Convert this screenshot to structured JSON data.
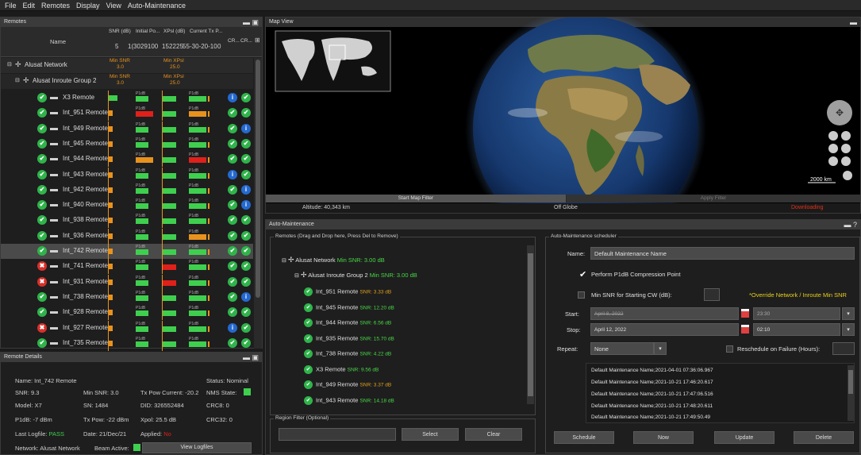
{
  "menu": [
    "File",
    "Edit",
    "Remotes",
    "Display",
    "View",
    "Auto-Maintenance"
  ],
  "remotes_panel": {
    "title": "Remotes",
    "col_name": "Name",
    "col_snr": "SNR (dB)",
    "col_initial": "Initial Po...",
    "col_xpsl": "XPsl (dB)",
    "col_tx": "Current Tx P...",
    "col_cr": "CR...",
    "col_cr2": "CR...",
    "scale_snr": "5",
    "scale_snr2": "1(",
    "scale_initial": "30",
    "scale_initial2": "29100",
    "scale_xpsl": "15",
    "scale_xpsl2": "22",
    "scale_xpsl3": "25",
    "scale_xpsl4": "55",
    "scale_tx": "-30-20-10",
    "scale_tx2": "0",
    "network": "Alusat Network",
    "network_min_snr": "Min SNR",
    "network_min_snr_val": "3.0",
    "network_min_xpsl": "Min XPsl",
    "network_min_xpsl_val": "25.0",
    "group": "Alusat Inroute Group 2",
    "group_min_snr": "Min SNR",
    "group_min_snr_val": "3.0",
    "group_min_xpsl": "Min XPsl",
    "group_min_xpsl_val": "25.0",
    "p1db": "P1dB",
    "rows": [
      {
        "name": "X3 Remote",
        "status": "ok",
        "i1": "info",
        "i2": "ok"
      },
      {
        "name": "Int_951 Remote",
        "status": "ok",
        "i1": "ok",
        "i2": "ok"
      },
      {
        "name": "Int_949 Remote",
        "status": "ok",
        "i1": "ok",
        "i2": "info"
      },
      {
        "name": "Int_945 Remote",
        "status": "ok",
        "i1": "ok",
        "i2": "ok"
      },
      {
        "name": "Int_944 Remote",
        "status": "ok",
        "i1": "ok",
        "i2": "ok"
      },
      {
        "name": "Int_943 Remote",
        "status": "ok",
        "i1": "info",
        "i2": "ok"
      },
      {
        "name": "Int_942 Remote",
        "status": "ok",
        "i1": "ok",
        "i2": "info"
      },
      {
        "name": "Int_940 Remote",
        "status": "ok",
        "i1": "ok",
        "i2": "info"
      },
      {
        "name": "Int_938 Remote",
        "status": "ok",
        "i1": "ok",
        "i2": "ok"
      },
      {
        "name": "Int_936 Remote",
        "status": "ok",
        "i1": "ok",
        "i2": "ok"
      },
      {
        "name": "Int_742 Remote",
        "status": "ok",
        "i1": "ok",
        "i2": "ok"
      },
      {
        "name": "Int_741 Remote",
        "status": "err",
        "i1": "ok",
        "i2": "ok"
      },
      {
        "name": "Int_931 Remote",
        "status": "err",
        "i1": "ok",
        "i2": "ok"
      },
      {
        "name": "Int_738 Remote",
        "status": "ok",
        "i1": "ok",
        "i2": "info"
      },
      {
        "name": "Int_928 Remote",
        "status": "ok",
        "i1": "ok",
        "i2": "ok"
      },
      {
        "name": "Int_927 Remote",
        "status": "err",
        "i1": "info",
        "i2": "ok"
      },
      {
        "name": "Int_735 Remote",
        "status": "ok",
        "i1": "ok",
        "i2": "ok"
      }
    ]
  },
  "details": {
    "title": "Remote Details",
    "name": "Name: Int_742 Remote",
    "status": "Status: Nominal",
    "snr": "SNR: 9.3",
    "min_snr": "Min SNR: 3.0",
    "tx_pow_current": "Tx Pow Current: -20.2",
    "nms_state": "NMS State:",
    "model": "Model: X7",
    "sn": "SN: 1484",
    "did": "DID: 326552484",
    "crc8": "CRC8: 0",
    "p1db": "P1dB: -7 dBm",
    "tx_pow": "Tx Pow: -22 dBm",
    "xpol": "Xpol: 25.5 dB",
    "crc32": "CRC32: 0",
    "last_logfile_label": "Last Logfile: ",
    "last_logfile_val": "PASS",
    "date": "Date: 21/Dec/21",
    "applied_label": "Applied: ",
    "applied_val": "No",
    "network": "Network: Alusat Network",
    "beam_active": "Beam Active:",
    "view_logfiles": "View Logfiles"
  },
  "map": {
    "title": "Map View",
    "start_filter": "Start Map Filter",
    "apply_filter": "Apply Filter",
    "altitude": "Altitude: 40,343 km",
    "off_globe": "Off Globe",
    "downloading": "Downloading",
    "scale": "2000 km"
  },
  "auto": {
    "title": "Auto-Maintenance",
    "remotes_group": "Remotes (Drag and Drop here, Press Del to Remove)",
    "network": "Alusat Network",
    "network_snr": "Min SNR: 3.00 dB",
    "group": "Alusat Inroute Group 2",
    "group_snr": "Min SNR: 3.00 dB",
    "items": [
      {
        "name": "Int_951 Remote",
        "snr": "SNR: 3.33 dB",
        "color": "#e0a020"
      },
      {
        "name": "Int_945 Remote",
        "snr": "SNR: 12.20 dB",
        "color": "#48d848"
      },
      {
        "name": "Int_944 Remote",
        "snr": "SNR: 6.56 dB",
        "color": "#48d848"
      },
      {
        "name": "Int_935 Remote",
        "snr": "SNR: 15.70 dB",
        "color": "#48d848"
      },
      {
        "name": "Int_738 Remote",
        "snr": "SNR: 4.22 dB",
        "color": "#48d848"
      },
      {
        "name": "X3 Remote",
        "snr": "SNR: 9.56 dB",
        "color": "#48d848"
      },
      {
        "name": "Int_949 Remote",
        "snr": "SNR: 3.37 dB",
        "color": "#e0a020"
      },
      {
        "name": "Int_943 Remote",
        "snr": "SNR: 14.18 dB",
        "color": "#48d848"
      }
    ],
    "region_group": "Region Filter (Optional)",
    "select": "Select",
    "clear": "Clear",
    "scheduler_group": "Auto-Maintenance scheduler",
    "name_label": "Name:",
    "name_value": "Default Maintenance Name",
    "perform_p1db": "Perform P1dB Compression Point",
    "min_snr_label": "Min SNR for Starting CW (dB):",
    "override": "*Override Network / Inroute Min SNR",
    "start_label": "Start:",
    "start_date": "April 8, 2022",
    "start_time": "23:30",
    "stop_label": "Stop:",
    "stop_date": "April 12, 2022",
    "stop_time": "02:10",
    "repeat_label": "Repeat:",
    "repeat_value": "None",
    "reschedule": "Reschedule on Failure (Hours):",
    "history": [
      "Default Maintenance Name;2021-04-01 07:36:06.967",
      "Default Maintenance Name;2021-10-21 17:46:20.617",
      "Default Maintenance Name;2021-10-21 17:47:06.516",
      "Default Maintenance Name;2021-10-21 17:48:20.611",
      "Default Maintenance Name;2021-10-21 17:49:50.49"
    ],
    "schedule": "Schedule",
    "now": "Now",
    "update": "Update",
    "delete": "Delete"
  },
  "colors": {
    "ok": "#2fb44a",
    "err": "#d9302a",
    "info": "#2469d0",
    "bar_green": "#3fcf4f",
    "bar_orange": "#e8921e",
    "bar_red": "#e0201a"
  }
}
